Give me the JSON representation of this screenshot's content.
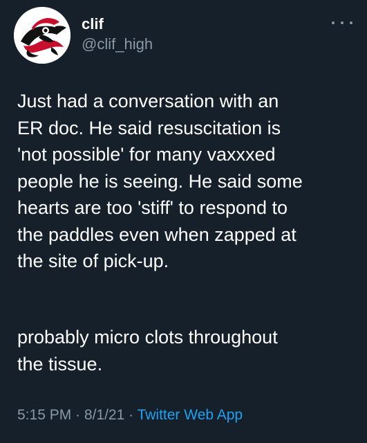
{
  "user": {
    "name": "clif",
    "handle": "@clif_high",
    "avatar_icon": "thunderbird-logo-icon"
  },
  "tweet": {
    "paragraph1": [
      "Just had a conversation with an",
      "ER doc. He said resuscitation is",
      "'not possible' for many vaxxxed",
      "people he is seeing. He said some",
      "hearts are too 'stiff' to respond to",
      "the paddles even when zapped at",
      "the site of pick-up."
    ],
    "paragraph2": [
      "probably micro clots throughout",
      "the tissue."
    ]
  },
  "meta": {
    "time": "5:15 PM",
    "separator": " · ",
    "date": "8/1/21",
    "app": "Twitter Web App"
  },
  "colors": {
    "background": "#15202b",
    "text": "#ffffff",
    "secondary": "#8899a6",
    "link": "#1da1f2",
    "avatar_red": "#c8102e",
    "avatar_black": "#111111"
  },
  "icons": {
    "more": "more-horizontal-icon"
  }
}
